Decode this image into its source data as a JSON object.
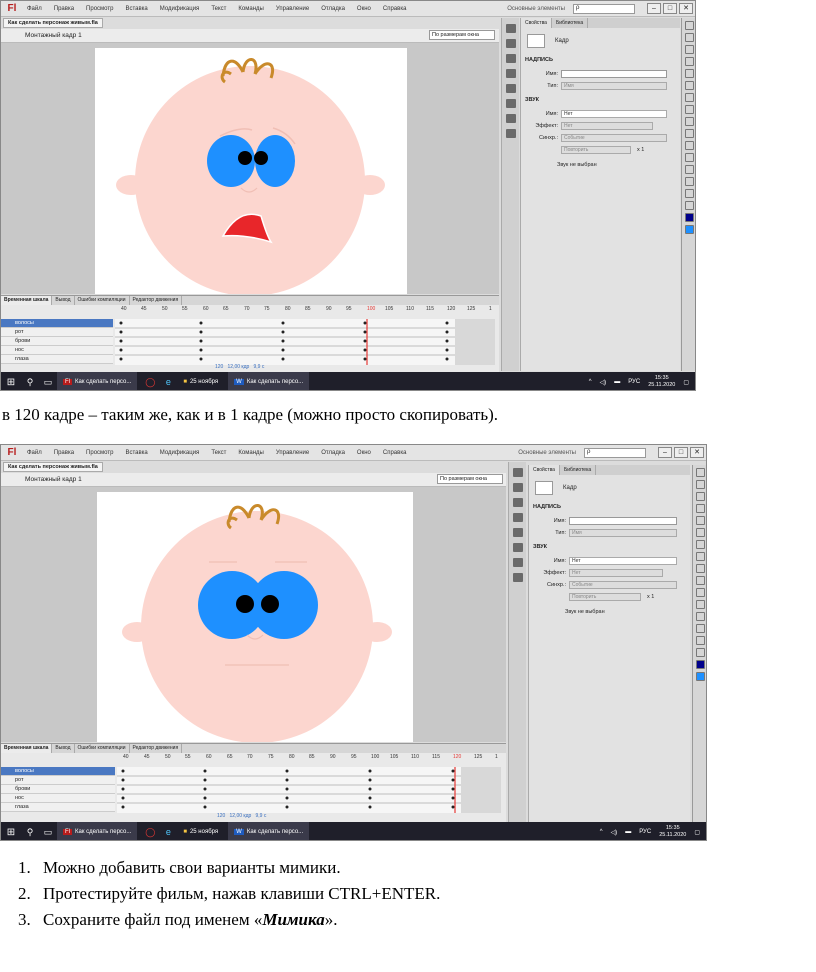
{
  "app": {
    "logo": "Fl",
    "menu": [
      "Файл",
      "Правка",
      "Просмотр",
      "Вставка",
      "Модификация",
      "Текст",
      "Команды",
      "Управление",
      "Отладка",
      "Окно",
      "Справка"
    ],
    "workspace": "Основные элементы",
    "search_icon": "ρ",
    "doc_tab": "Как сделать персонаж живым.fla",
    "scene": "Монтажный кадр 1",
    "zoom": "По размерам окна",
    "tl_tabs": [
      "Временная шкала",
      "Вывод",
      "Ошибки компиляции",
      "Редактор движения"
    ],
    "ruler": [
      "40",
      "45",
      "50",
      "55",
      "60",
      "65",
      "70",
      "75",
      "80",
      "85",
      "90",
      "95",
      "100",
      "105",
      "110",
      "115",
      "120",
      "125",
      "1"
    ],
    "layers": [
      "волосы",
      "рот",
      "брови",
      "нос",
      "глаза"
    ],
    "tl_status1": [
      "120",
      "12,00 кдр",
      "9,9 с"
    ],
    "tl_status2": [
      "120",
      "12,00 кдр",
      "9,9 с"
    ],
    "props_tabs": [
      "Свойства",
      "Библиотека"
    ],
    "frame_label": "Кадр",
    "sec_label": "НАДПИСЬ",
    "name_label": "Имя:",
    "type_label": "Тип:",
    "type_value": "Имя",
    "sound_sec": "ЗВУК",
    "sound_name_value": "Нет",
    "effect_label": "Эффект:",
    "effect_value": "Нет",
    "sync_label": "Синхр.:",
    "sync_value": "Событие",
    "repeat_value": "Повторить",
    "repeat_x": "x 1",
    "no_sound": "Звук не выбран",
    "lang": "РУС",
    "time": "15:35",
    "date": "25.11.2020",
    "taskbar": [
      "Как сделать персо...",
      "25 ноября",
      "Как сделать персо..."
    ]
  },
  "caption": "в 120 кадре – таким же, как и в 1 кадре (можно просто скопировать).",
  "steps": [
    "Можно добавить свои варианты мимики.",
    "Протестируйте фильм, нажав клавиши CTRL+ENTER.",
    "Сохраните файл под именем «Мимика»."
  ],
  "step3_prefix": "Сохраните файл под именем «",
  "step3_bold": "Мимика",
  "step3_suffix": "».",
  "colors": {
    "face": "#fcd6cf",
    "eye": "#1e90ff",
    "mouth": "#e8262a",
    "hair": "#c98a2b",
    "playhead": "#e53935",
    "selected_layer": "#4a78c2"
  }
}
